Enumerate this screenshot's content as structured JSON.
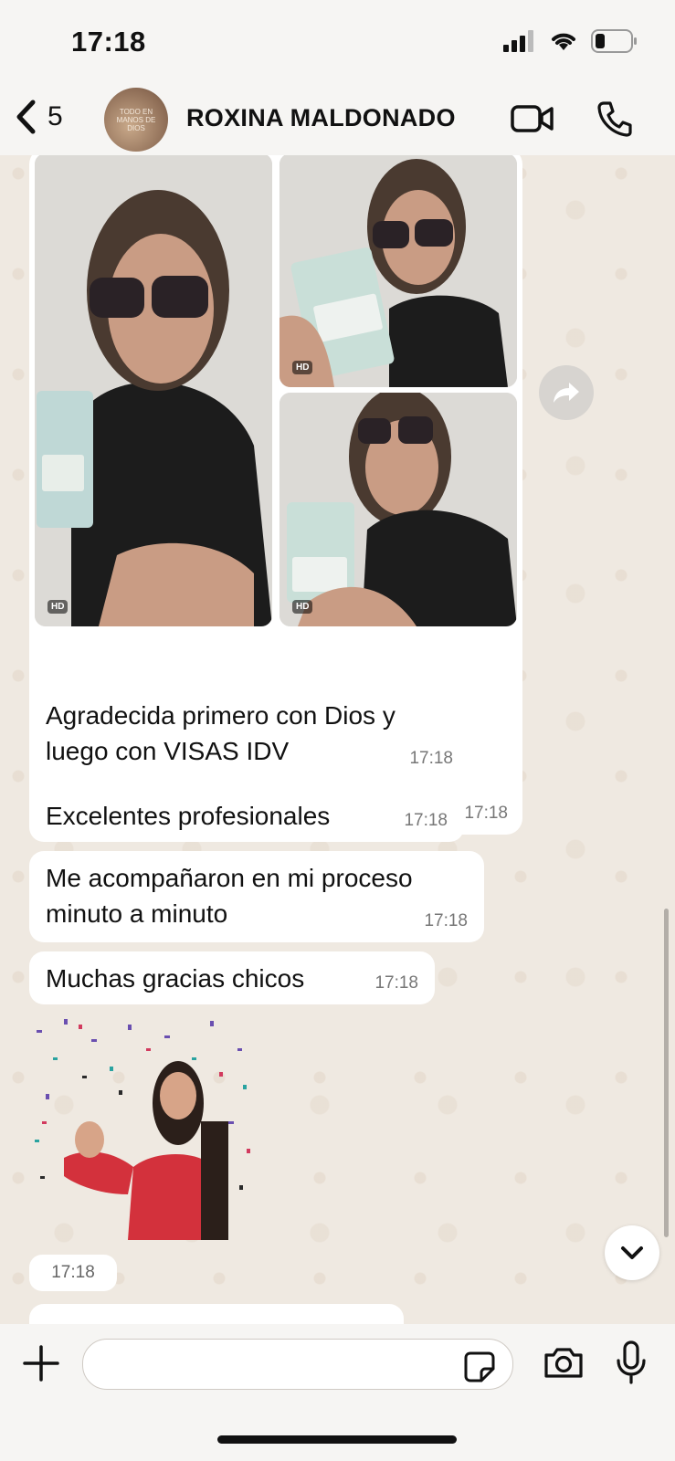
{
  "status_bar": {
    "time": "17:18"
  },
  "header": {
    "back_count": "5",
    "avatar_text": "TODO EN MANOS DE DIOS",
    "contact_name": "ROXINA MALDONADO"
  },
  "photo_message": {
    "hd_label": "HD",
    "time": "17:18"
  },
  "messages": [
    {
      "text": "Agradecida primero con Dios y luego con VISAS IDV",
      "time": "17:18"
    },
    {
      "text": "Excelentes profesionales",
      "time": "17:18"
    },
    {
      "text": "Me acompañaron en mi proceso minuto a minuto",
      "time": "17:18"
    },
    {
      "text": "Muchas gracias chicos",
      "time": "17:18"
    }
  ],
  "sticker_message": {
    "time": "17:18"
  },
  "colors": {
    "bubble": "#ffffff",
    "chat_bg": "#efe9e1",
    "bar_bg": "#f6f5f3"
  }
}
